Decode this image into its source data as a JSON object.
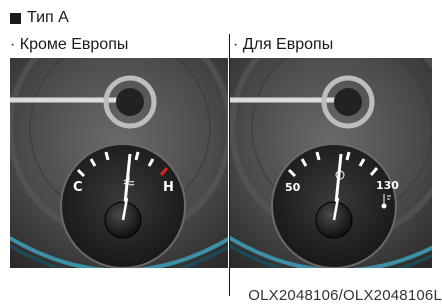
{
  "heading": "Тип A",
  "variants": [
    {
      "label": "· Кроме Европы",
      "gauge": {
        "low": "C",
        "high": "H"
      }
    },
    {
      "label": "· Для Европы",
      "gauge": {
        "low": "50",
        "high": "130"
      }
    }
  ],
  "caption": "OLX2048106/OLX2048106L",
  "colors": {
    "needle_marks": "#ffffff",
    "hot_zone": "#e02020",
    "ring": "#3d8fa8"
  },
  "icons": {
    "coolant": "coolant-temperature-icon"
  }
}
